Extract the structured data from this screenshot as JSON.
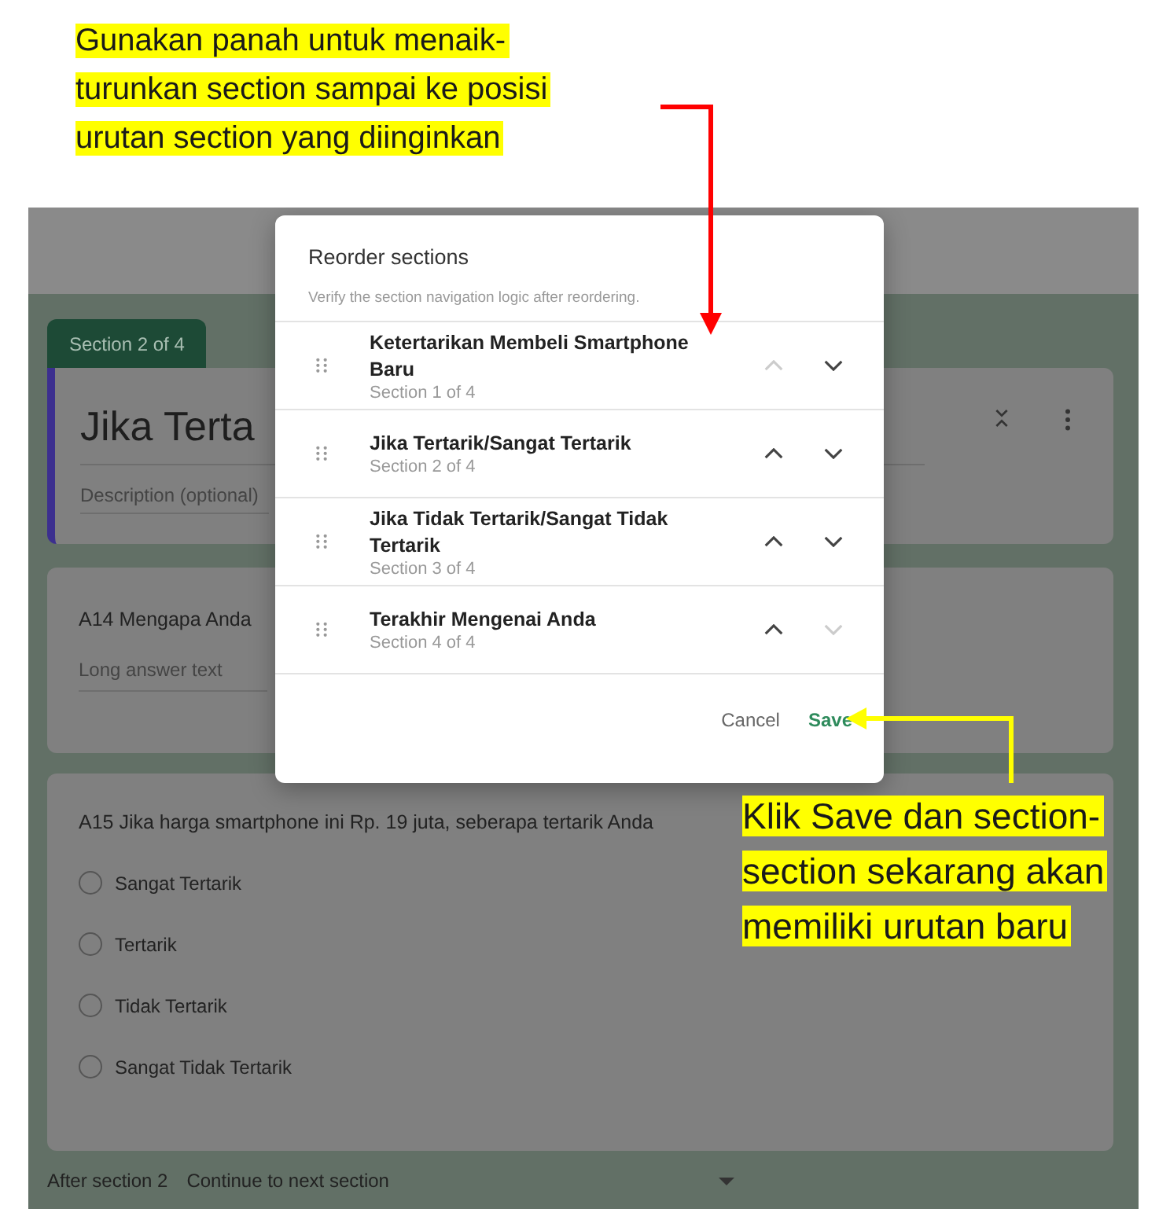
{
  "callout_top": {
    "lines": [
      "Gunakan panah untuk menaik-",
      "turunkan section sampai ke posisi",
      "urutan section yang diinginkan"
    ]
  },
  "form": {
    "section_tab": "Section 2 of 4",
    "title": "Jika Terta",
    "description_placeholder": "Description (optional)",
    "question_1": {
      "title": "A14 Mengapa Anda",
      "placeholder": "Long answer text"
    },
    "question_2": {
      "title": "A15 Jika harga smartphone ini Rp. 19 juta, seberapa tertarik Anda",
      "options": [
        {
          "label": "Sangat Tertarik",
          "selected": false
        },
        {
          "label": "Tertarik",
          "selected": false
        },
        {
          "label": "Tidak Tertarik",
          "selected": false
        },
        {
          "label": "Sangat Tidak Tertarik",
          "selected": false
        }
      ]
    },
    "after_section": {
      "label": "After section 2",
      "value": "Continue to next section"
    }
  },
  "dialog": {
    "title": "Reorder sections",
    "subtitle": "Verify the section navigation logic after reordering.",
    "sections": [
      {
        "name": "Ketertarikan Membeli Smartphone Baru",
        "position": "Section 1 of 4",
        "up_disabled": true,
        "down_disabled": false
      },
      {
        "name": "Jika Tertarik/Sangat Tertarik",
        "position": "Section 2 of 4",
        "up_disabled": false,
        "down_disabled": false
      },
      {
        "name": "Jika Tidak Tertarik/Sangat Tidak Tertarik",
        "position": "Section 3 of 4",
        "up_disabled": false,
        "down_disabled": false
      },
      {
        "name": "Terakhir Mengenai Anda",
        "position": "Section 4 of 4",
        "up_disabled": false,
        "down_disabled": true
      }
    ],
    "buttons": {
      "cancel": "Cancel",
      "save": "Save"
    }
  },
  "callout_bottom": {
    "lines": [
      "Klik Save dan section-",
      "section sekarang akan",
      "memiliki urutan baru"
    ]
  }
}
